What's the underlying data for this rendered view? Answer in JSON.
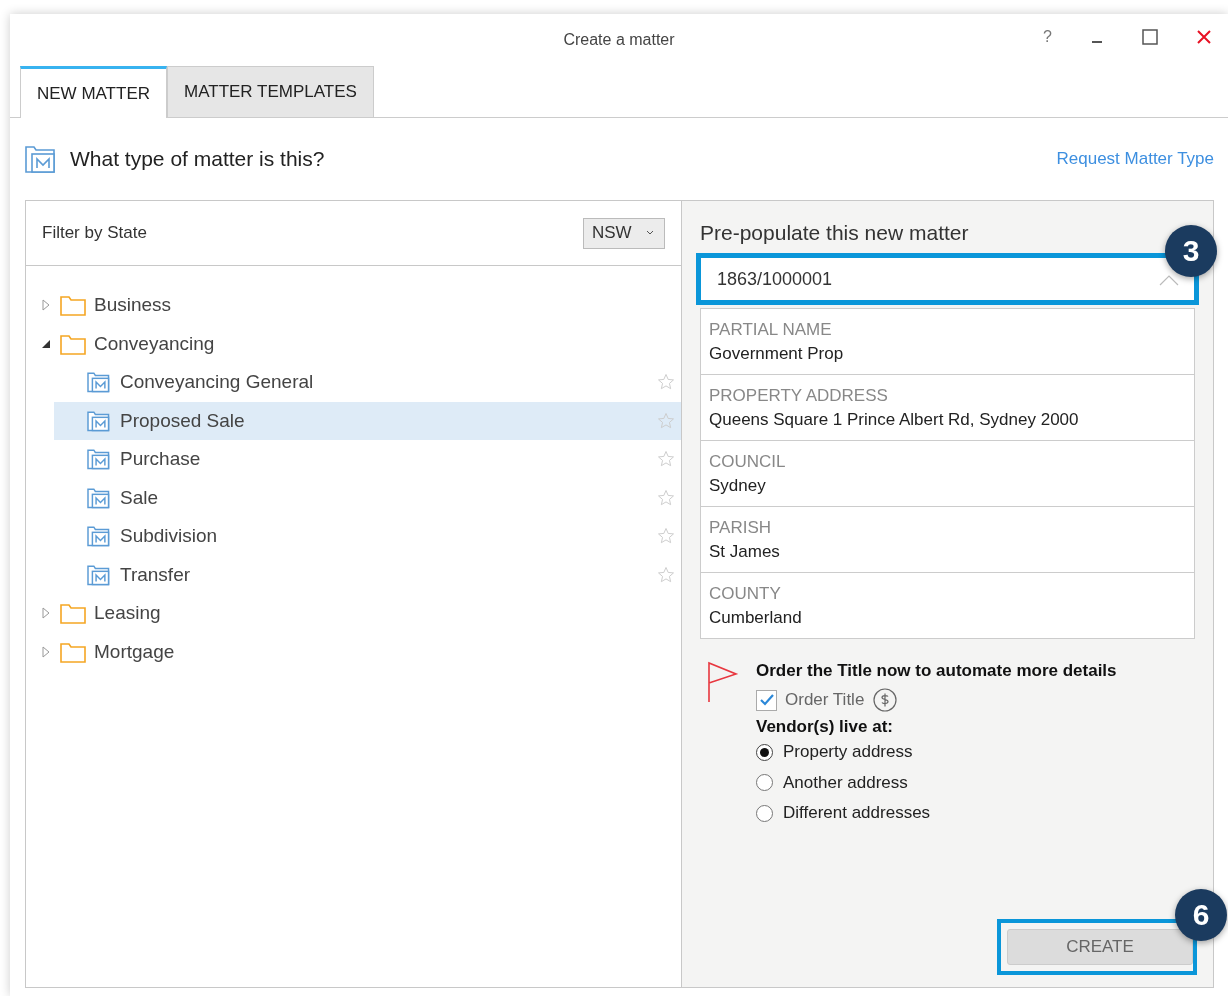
{
  "window": {
    "title": "Create a matter",
    "help": "?"
  },
  "tabs": [
    {
      "label": "NEW MATTER",
      "selected": true
    },
    {
      "label": "MATTER TEMPLATES",
      "selected": false
    }
  ],
  "heading": "What type of matter is this?",
  "request_link": "Request Matter Type",
  "filter": {
    "label": "Filter by State",
    "value": "NSW"
  },
  "tree": [
    {
      "label": "Business",
      "expanded": false
    },
    {
      "label": "Conveyancing",
      "expanded": true,
      "children": [
        {
          "label": "Conveyancing General",
          "selected": false
        },
        {
          "label": "Proposed Sale",
          "selected": true
        },
        {
          "label": "Purchase",
          "selected": false
        },
        {
          "label": "Sale",
          "selected": false
        },
        {
          "label": "Subdivision",
          "selected": false
        },
        {
          "label": "Transfer",
          "selected": false
        }
      ]
    },
    {
      "label": "Leasing",
      "expanded": false
    },
    {
      "label": "Mortgage",
      "expanded": false
    }
  ],
  "prepopulate": {
    "title": "Pre-populate this new matter",
    "value": "1863/1000001",
    "callout": "3",
    "details": [
      {
        "label": "PARTIAL NAME",
        "value": "Government Prop"
      },
      {
        "label": "PROPERTY ADDRESS",
        "value": "Queens Square 1 Prince Albert Rd, Sydney 2000"
      },
      {
        "label": "COUNCIL",
        "value": "Sydney"
      },
      {
        "label": "PARISH",
        "value": "St James"
      },
      {
        "label": "COUNTY",
        "value": "Cumberland"
      }
    ]
  },
  "order": {
    "title": "Order the Title now to automate more details",
    "checkbox": {
      "label": "Order Title",
      "checked": true
    },
    "vendor_label": "Vendor(s) live at:",
    "options": [
      {
        "label": "Property address",
        "selected": true
      },
      {
        "label": "Another address",
        "selected": false
      },
      {
        "label": "Different addresses",
        "selected": false
      }
    ]
  },
  "create": {
    "label": "CREATE",
    "disabled": true,
    "callout": "6"
  }
}
